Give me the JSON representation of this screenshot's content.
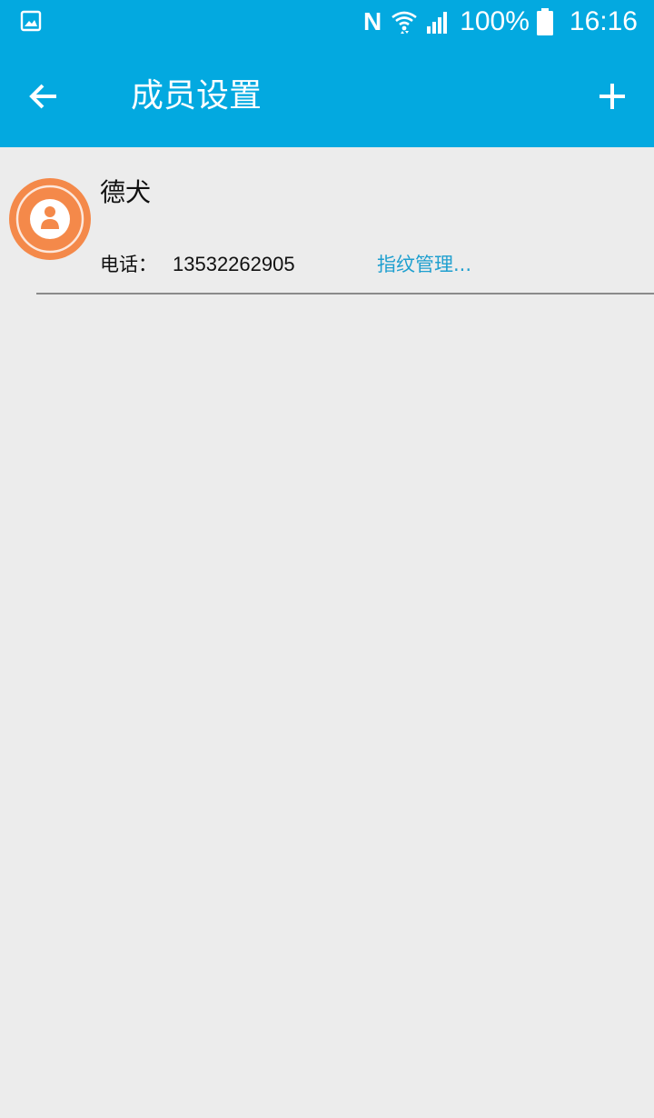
{
  "status_bar": {
    "battery_percent": "100%",
    "time": "16:16",
    "icons": [
      "gallery-icon",
      "nfc-icon",
      "wifi-icon",
      "signal-icon",
      "battery-icon"
    ]
  },
  "app_bar": {
    "title": "成员设置",
    "back_icon": "arrow-left-icon",
    "add_icon": "plus-icon"
  },
  "members": [
    {
      "name": "德犬",
      "phone_label": "电话：",
      "phone": "13532262905",
      "fingerprint_link": "指纹管理...",
      "avatar_icon": "person-icon"
    }
  ],
  "colors": {
    "primary": "#03a9e0",
    "avatar": "#f4894a",
    "link": "#1e9fcf",
    "background": "#ececec"
  }
}
